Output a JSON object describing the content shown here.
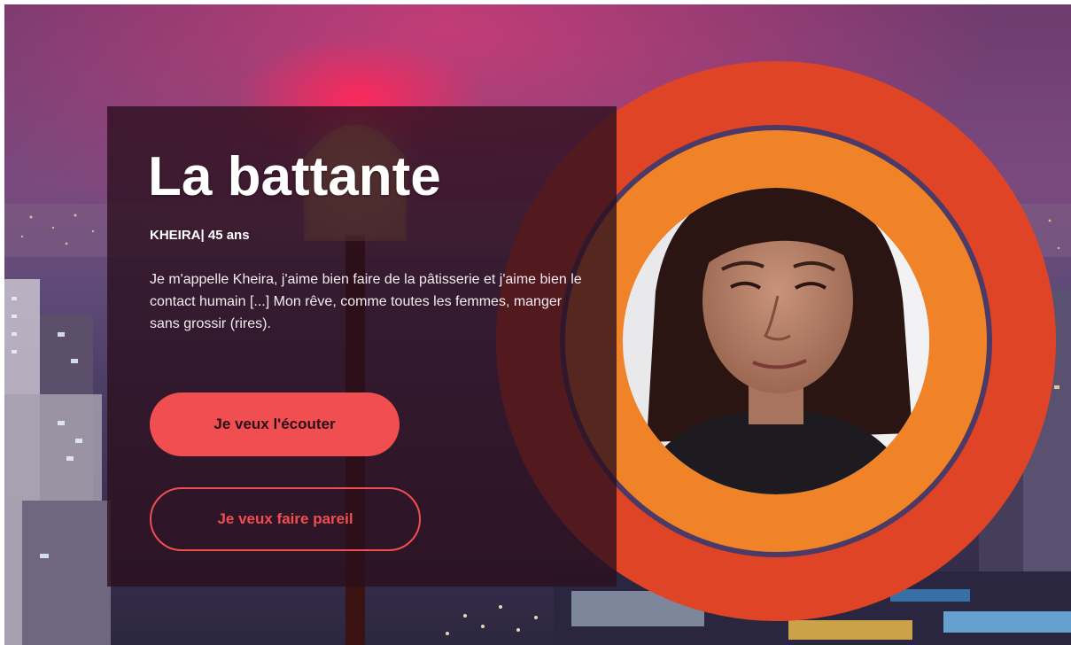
{
  "hero": {
    "title": "La battante",
    "subtitle": "KHEIRA| 45 ans",
    "description": "Je m'appelle Kheira, j'aime bien faire de la pâtisserie et j'aime bien le contact humain [...] Mon rêve, comme toutes les femmes, manger sans grossir (rires).",
    "primary_button_label": "Je veux l'écouter",
    "secondary_button_label": "Je veux faire pareil"
  },
  "colors": {
    "accent": "#f04e50",
    "ring_outer": "#e04426",
    "ring_inner": "#f08228",
    "panel": "#2a0e1c"
  },
  "portrait": {
    "icon": "person-portrait-icon"
  }
}
